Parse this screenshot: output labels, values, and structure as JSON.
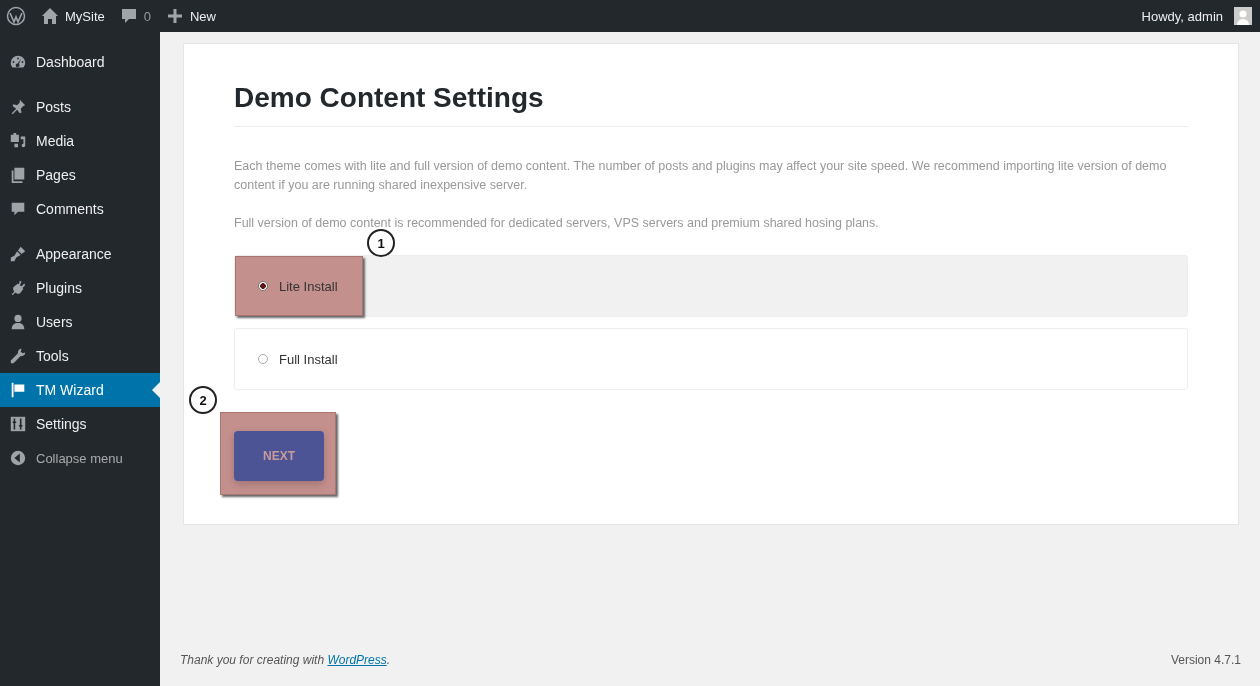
{
  "admin_bar": {
    "site_name": "MySite",
    "comments_count": "0",
    "new_label": "New",
    "greeting": "Howdy, admin"
  },
  "sidebar": {
    "groups": [
      [
        {
          "label": "Dashboard",
          "selected": false
        }
      ],
      [
        {
          "label": "Posts",
          "selected": false
        },
        {
          "label": "Media",
          "selected": false
        },
        {
          "label": "Pages",
          "selected": false
        },
        {
          "label": "Comments",
          "selected": false
        }
      ],
      [
        {
          "label": "Appearance",
          "selected": false
        },
        {
          "label": "Plugins",
          "selected": false
        },
        {
          "label": "Users",
          "selected": false
        },
        {
          "label": "Tools",
          "selected": false
        },
        {
          "label": "TM Wizard",
          "selected": true
        },
        {
          "label": "Settings",
          "selected": false
        }
      ]
    ],
    "collapse_label": "Collapse menu"
  },
  "wizard": {
    "title": "Demo Content Settings",
    "paragraphs": [
      "Each theme comes with lite and full version of demo content. The number of posts and plugins may affect your site speed. We recommend importing lite version of demo content if you are running shared inexpensive server.",
      "Full version of demo content is recommended for dedicated servers, VPS servers and premium shared hosing plans."
    ],
    "options": [
      {
        "label": "Lite Install",
        "selected": true,
        "annotation": "1"
      },
      {
        "label": "Full Install",
        "selected": false
      }
    ],
    "next_button": {
      "label": "NEXT",
      "annotation": "2"
    }
  },
  "footer": {
    "thanks_prefix": "Thank you for creating with ",
    "thanks_link": "WordPress",
    "thanks_suffix": ".",
    "version": "Version 4.7.1"
  }
}
